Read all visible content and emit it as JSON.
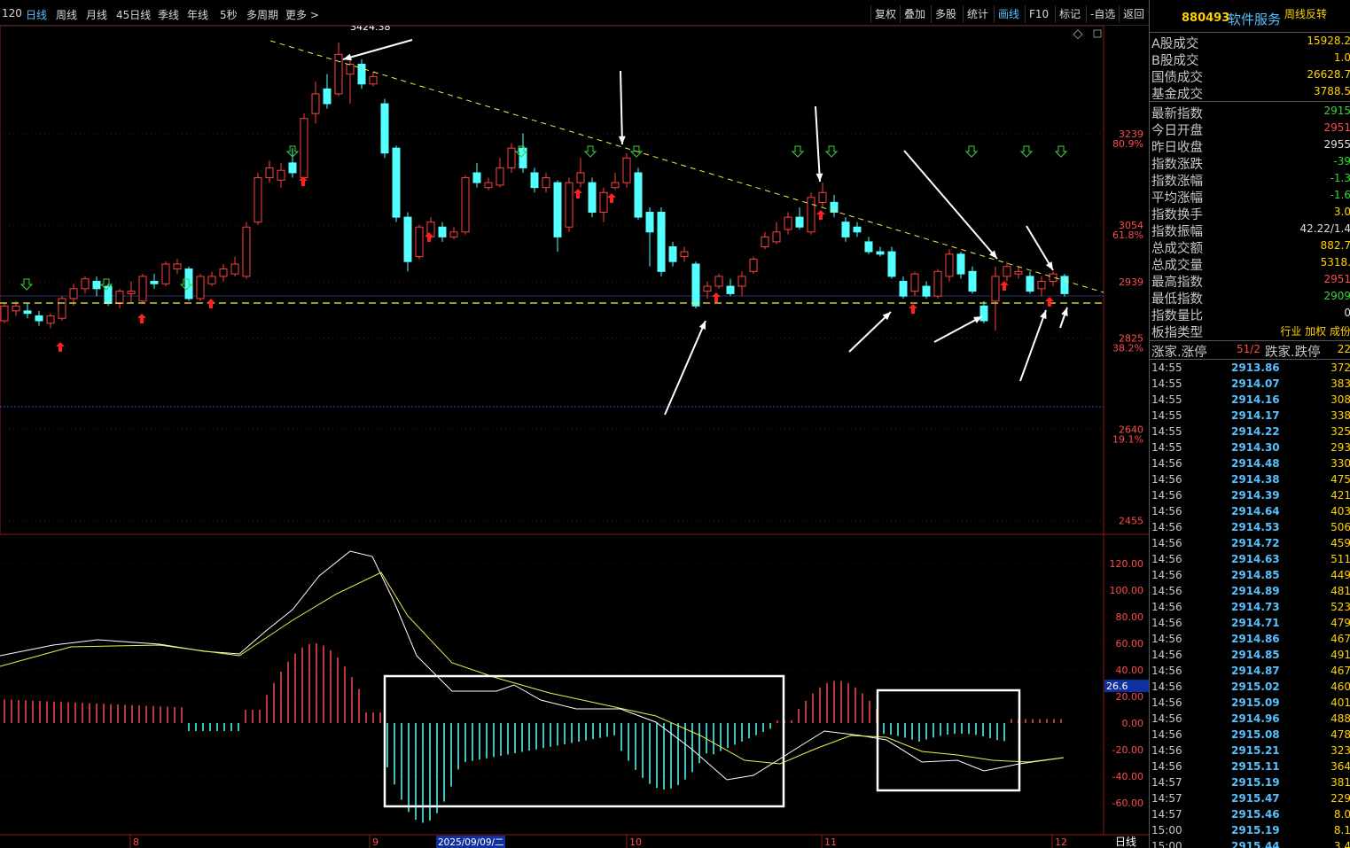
{
  "topbar": {
    "periods": [
      {
        "label": "120"
      },
      {
        "label": "日线"
      },
      {
        "label": "周线"
      },
      {
        "label": "月线"
      },
      {
        "label": "45日线"
      },
      {
        "label": "季线"
      },
      {
        "label": "年线"
      },
      {
        "label": "5秒"
      },
      {
        "label": "多周期"
      },
      {
        "label": "更多 >"
      }
    ],
    "tools": [
      {
        "label": "复权"
      },
      {
        "label": "叠加"
      },
      {
        "label": "多股"
      },
      {
        "label": "统计"
      },
      {
        "label": "画线"
      },
      {
        "label": "F10"
      },
      {
        "label": "标记"
      },
      {
        "label": "-自选"
      },
      {
        "label": "返回"
      }
    ]
  },
  "side": {
    "code": "880493",
    "name": "软件服务",
    "flag": "周线反转",
    "stats": [
      {
        "label": "A股成交",
        "value": "15928.2"
      },
      {
        "label": "B股成交",
        "value": "1.0"
      },
      {
        "label": "国债成交",
        "value": "26628.7"
      },
      {
        "label": "基金成交",
        "value": "3788.5"
      },
      {
        "label": "最新指数",
        "value": "2915"
      },
      {
        "label": "今日开盘",
        "value": "2951"
      },
      {
        "label": "昨日收盘",
        "value": "2955"
      },
      {
        "label": "指数涨跌",
        "value": "-39"
      },
      {
        "label": "指数涨幅",
        "value": "-1.3"
      },
      {
        "label": "平均涨幅",
        "value": "-1.6"
      },
      {
        "label": "指数换手",
        "value": "3.0"
      },
      {
        "label": "指数振幅",
        "value": "42.22/1.4"
      },
      {
        "label": "总成交额",
        "value": "882.7"
      },
      {
        "label": "总成交量",
        "value": "5318."
      },
      {
        "label": "最高指数",
        "value": "2951"
      },
      {
        "label": "最低指数",
        "value": "2909"
      },
      {
        "label": "指数量比",
        "value": "0"
      },
      {
        "label": "板指类型",
        "value": "行业 加权 成份"
      }
    ],
    "updown": {
      "label1": "涨家.涨停",
      "value1": "51/2",
      "label2": "跌家.跌停",
      "value2": "22"
    },
    "ticks": [
      {
        "t": "14:55",
        "p": "2913.86",
        "v": "372"
      },
      {
        "t": "14:55",
        "p": "2914.07",
        "v": "383"
      },
      {
        "t": "14:55",
        "p": "2914.16",
        "v": "308"
      },
      {
        "t": "14:55",
        "p": "2914.17",
        "v": "338"
      },
      {
        "t": "14:55",
        "p": "2914.22",
        "v": "325"
      },
      {
        "t": "14:55",
        "p": "2914.30",
        "v": "293"
      },
      {
        "t": "14:56",
        "p": "2914.48",
        "v": "330"
      },
      {
        "t": "14:56",
        "p": "2914.38",
        "v": "475"
      },
      {
        "t": "14:56",
        "p": "2914.39",
        "v": "421"
      },
      {
        "t": "14:56",
        "p": "2914.64",
        "v": "403"
      },
      {
        "t": "14:56",
        "p": "2914.53",
        "v": "506"
      },
      {
        "t": "14:56",
        "p": "2914.72",
        "v": "459"
      },
      {
        "t": "14:56",
        "p": "2914.63",
        "v": "511"
      },
      {
        "t": "14:56",
        "p": "2914.85",
        "v": "449"
      },
      {
        "t": "14:56",
        "p": "2914.89",
        "v": "481"
      },
      {
        "t": "14:56",
        "p": "2914.73",
        "v": "523"
      },
      {
        "t": "14:56",
        "p": "2914.71",
        "v": "479"
      },
      {
        "t": "14:56",
        "p": "2914.86",
        "v": "467"
      },
      {
        "t": "14:56",
        "p": "2914.85",
        "v": "491"
      },
      {
        "t": "14:56",
        "p": "2914.87",
        "v": "467"
      },
      {
        "t": "14:56",
        "p": "2915.02",
        "v": "460"
      },
      {
        "t": "14:56",
        "p": "2915.09",
        "v": "401"
      },
      {
        "t": "14:56",
        "p": "2914.96",
        "v": "488"
      },
      {
        "t": "14:56",
        "p": "2915.08",
        "v": "478"
      },
      {
        "t": "14:56",
        "p": "2915.21",
        "v": "323"
      },
      {
        "t": "14:56",
        "p": "2915.11",
        "v": "364"
      },
      {
        "t": "14:57",
        "p": "2915.19",
        "v": "381"
      },
      {
        "t": "14:57",
        "p": "2915.47",
        "v": "229"
      },
      {
        "t": "14:57",
        "p": "2915.46",
        "v": "8.0"
      },
      {
        "t": "15:00",
        "p": "2915.19",
        "v": "8.1"
      },
      {
        "t": "15:00",
        "p": "2915.44",
        "v": "3.4"
      }
    ]
  },
  "chart": {
    "high_label": "3424.38",
    "price_ticks": [
      {
        "value": 3239,
        "label": "3239",
        "pct": "80.9%"
      },
      {
        "value": 3054,
        "label": "3054",
        "pct": "61.8%"
      },
      {
        "value": 2939,
        "label": "2939",
        "pct": ""
      },
      {
        "value": 2825,
        "label": "2825",
        "pct": "38.2%"
      },
      {
        "value": 2640,
        "label": "2640",
        "pct": "19.1%"
      },
      {
        "value": 2455,
        "label": "2455",
        "pct": ""
      }
    ],
    "macd_ticks": [
      "120.00",
      "100.00",
      "80.00",
      "60.00",
      "40.00",
      "20.00",
      "0.00",
      "-20.00",
      "-40.00",
      "-60.00"
    ],
    "macd_value": "26.6",
    "date_ticks": [
      "8",
      "9",
      "10",
      "11",
      "12"
    ],
    "date_highlight": "2025/09/09/二",
    "axis_corner": "日线"
  },
  "colors": {
    "up": "#ff4040",
    "down": "#54ffff",
    "dif": "#ffffff",
    "dea": "#f0f050",
    "trend": "#f0f050"
  }
}
